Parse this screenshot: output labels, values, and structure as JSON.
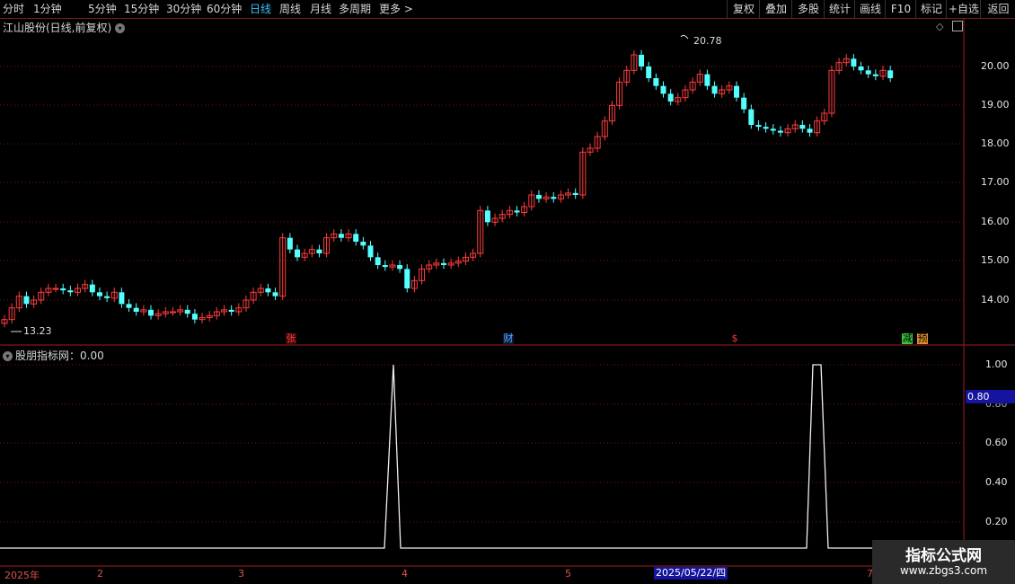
{
  "toolbar": {
    "periods": [
      "分时",
      "1分钟",
      "5分钟",
      "15分钟",
      "30分钟",
      "60分钟",
      "日线",
      "周线",
      "月线",
      "多周期",
      "更多"
    ],
    "active_period": "日线",
    "right_buttons": [
      "复权",
      "叠加",
      "多股",
      "统计",
      "画线",
      "F10",
      "标记",
      "+自选",
      "返回"
    ]
  },
  "main_chart": {
    "title": "江山股份(日线,前复权)",
    "price_ticks": [
      "20.00",
      "19.00",
      "18.00",
      "17.00",
      "16.00",
      "15.00",
      "14.00"
    ],
    "high_label": "20.78",
    "low_label": "13.23",
    "event_markers": [
      "张",
      "财",
      "$",
      "减",
      "预"
    ]
  },
  "indicator": {
    "title": "股朋指标网：0.00",
    "ticks": [
      "1.00",
      "0.60",
      "0.40",
      "0.20"
    ],
    "current_value_tag": "0.80",
    "hidden_tick": "0.80"
  },
  "date_axis": {
    "labels": [
      "2025年",
      "2",
      "3",
      "4",
      "5",
      "7"
    ],
    "cursor_date": "2025/05/22/四"
  },
  "watermark": {
    "title": "指标公式网",
    "url": "www.zbgs3.com"
  },
  "colors": {
    "up": "#ff3c3c",
    "down": "#54ffff",
    "grid": "#7a1414",
    "active": "#34c6ff"
  }
}
